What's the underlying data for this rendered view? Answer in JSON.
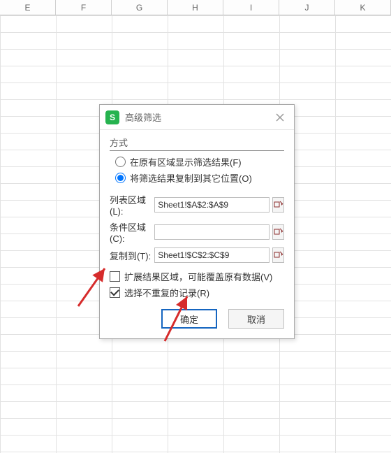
{
  "columns": [
    "E",
    "F",
    "G",
    "H",
    "I",
    "J",
    "K"
  ],
  "dialog": {
    "title": "高级筛选",
    "app_icon_letter": "S",
    "section_label": "方式",
    "radios": {
      "in_place": "在原有区域显示筛选结果(F)",
      "copy_to": "将筛选结果复制到其它位置(O)"
    },
    "fields": {
      "list_range": {
        "label": "列表区域(L):",
        "value": "Sheet1!$A$2:$A$9"
      },
      "criteria_range": {
        "label": "条件区域(C):",
        "value": ""
      },
      "copy_to": {
        "label": "复制到(T):",
        "value": "Sheet1!$C$2:$C$9"
      }
    },
    "checks": {
      "extend": "扩展结果区域，可能覆盖原有数据(V)",
      "unique": "选择不重复的记录(R)"
    },
    "buttons": {
      "ok": "确定",
      "cancel": "取消"
    }
  }
}
